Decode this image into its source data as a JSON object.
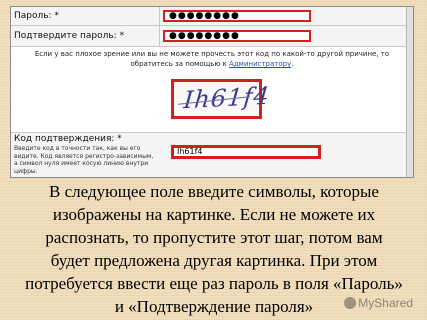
{
  "form": {
    "password_label": "Пароль: *",
    "password_value": "●●●●●●●●",
    "confirm_label": "Подтвердите пароль: *",
    "confirm_value": "●●●●●●●●",
    "notice_text": "Если у вас плохое зрение или вы не можете прочесть этот код по какой-то другой причине, то обратитесь за помощью к",
    "notice_link": "Администратору",
    "notice_end": ".",
    "captcha_text": "Ih61f4",
    "code_label": "Код подтверждения: *",
    "code_help": "Введите код в точности так, как вы его видите. Код является регистро-зависимым, а символ нуля имеет косую линию внутри цифры.",
    "code_value": "Ih61f4"
  },
  "caption": {
    "text": "В следующее поле введите символы, которые изображены на картинке. Если не можете их распознать, то пропустите этот шаг, потом вам будет предложена другая картинка. При этом потребуется ввести еще раз пароль в поля «Пароль» и «Подтверждение пароля»"
  },
  "watermark": {
    "text": "MyShared"
  }
}
